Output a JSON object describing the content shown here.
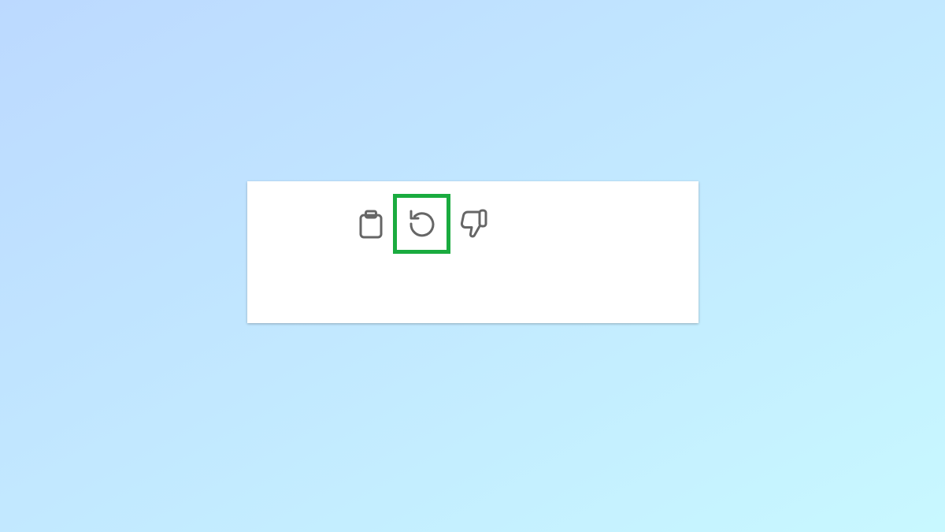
{
  "theme": {
    "background_gradient_start": "#bcd9ff",
    "background_gradient_end": "#c8f8ff",
    "card_background": "#ffffff",
    "icon_color": "#666666",
    "highlight_color": "#1aab3f"
  },
  "message_actions": {
    "copy": {
      "icon": "clipboard-icon",
      "label": ""
    },
    "retry": {
      "icon": "retry-icon",
      "label": "",
      "highlighted": true
    },
    "dislike": {
      "icon": "thumbs-down-icon",
      "label": ""
    }
  }
}
